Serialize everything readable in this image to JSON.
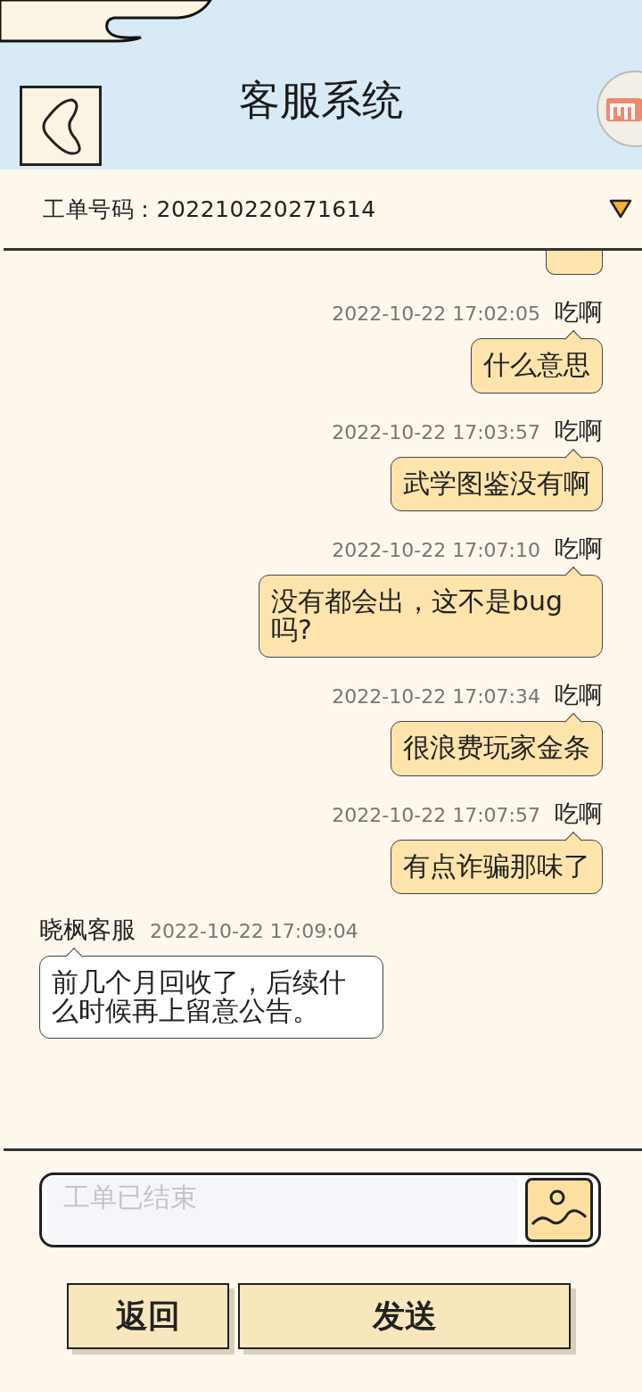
{
  "header": {
    "title": "客服系统"
  },
  "ticket": {
    "label": "工单号码：",
    "number": "202210220271614"
  },
  "messages": [
    {
      "kind": "user",
      "sender": "吃啊",
      "time": "2022-10-22 17:02:05",
      "text": "什么意思"
    },
    {
      "kind": "user",
      "sender": "吃啊",
      "time": "2022-10-22 17:03:57",
      "text": "武学图鉴没有啊"
    },
    {
      "kind": "user",
      "sender": "吃啊",
      "time": "2022-10-22 17:07:10",
      "text": "没有都会出，这不是bug吗?"
    },
    {
      "kind": "user",
      "sender": "吃啊",
      "time": "2022-10-22 17:07:34",
      "text": "很浪费玩家金条"
    },
    {
      "kind": "user",
      "sender": "吃啊",
      "time": "2022-10-22 17:07:57",
      "text": "有点诈骗那味了"
    },
    {
      "kind": "agent",
      "sender": "晓枫客服",
      "time": "2022-10-22 17:09:04",
      "text": "前几个月回收了，后续什么时候再上留意公告。"
    }
  ],
  "input": {
    "placeholder": "工单已结束"
  },
  "buttons": [
    {
      "kind": "back",
      "label": "返回"
    },
    {
      "kind": "send",
      "label": "发送"
    }
  ]
}
